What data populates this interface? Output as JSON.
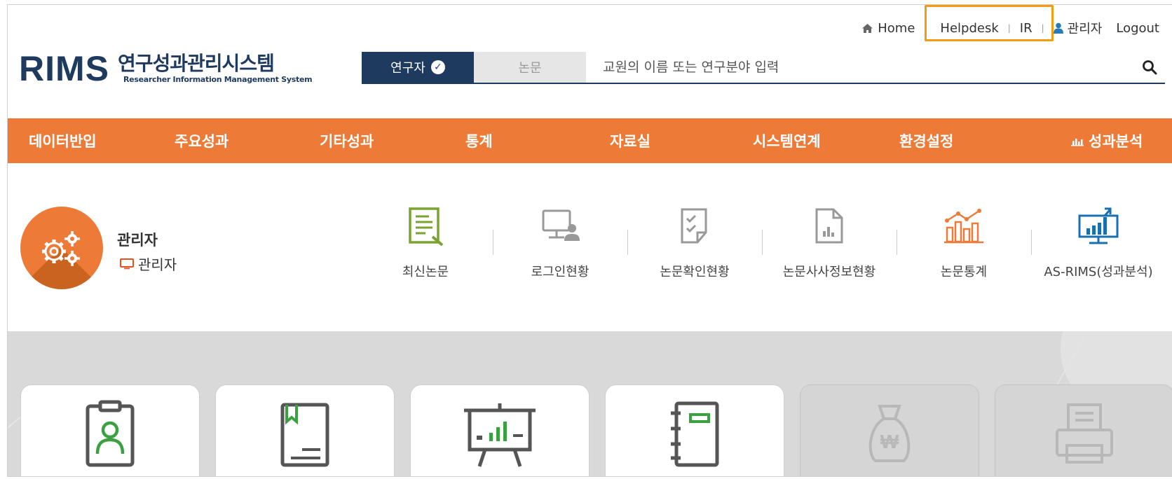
{
  "header": {
    "util": {
      "home": "Home",
      "helpdesk": "Helpdesk",
      "ir": "IR",
      "user": "관리자",
      "logout": "Logout"
    },
    "logo": {
      "mark": "RIMS",
      "title_kr": "연구성과관리시스템",
      "title_en": "Researcher Information Management System"
    },
    "search": {
      "tab_active": "연구자",
      "tab_inactive": "논문",
      "placeholder": "교원의 이름 또는 연구분야 입력"
    }
  },
  "nav": {
    "items": [
      "데이터반입",
      "주요성과",
      "기타성과",
      "통계",
      "자료실",
      "시스템연계",
      "환경설정"
    ],
    "analysis": "성과분석"
  },
  "profile": {
    "name": "관리자",
    "role": "관리자"
  },
  "quick_menu": [
    {
      "label": "최신논문"
    },
    {
      "label": "로그인현황"
    },
    {
      "label": "논문확인현황"
    },
    {
      "label": "논문사사정보현황"
    },
    {
      "label": "논문통계"
    },
    {
      "label": "AS-RIMS(성과분석)"
    }
  ],
  "colors": {
    "brand_navy": "#1e3a5f",
    "nav_orange": "#ed7b37",
    "highlight": "#f39c12",
    "icon_green": "#7aa330",
    "icon_blue": "#1a6fb0"
  },
  "icons": [
    "home-icon",
    "user-icon",
    "check-icon",
    "search-icon",
    "chart-icon",
    "gears-icon",
    "monitor-icon"
  ]
}
